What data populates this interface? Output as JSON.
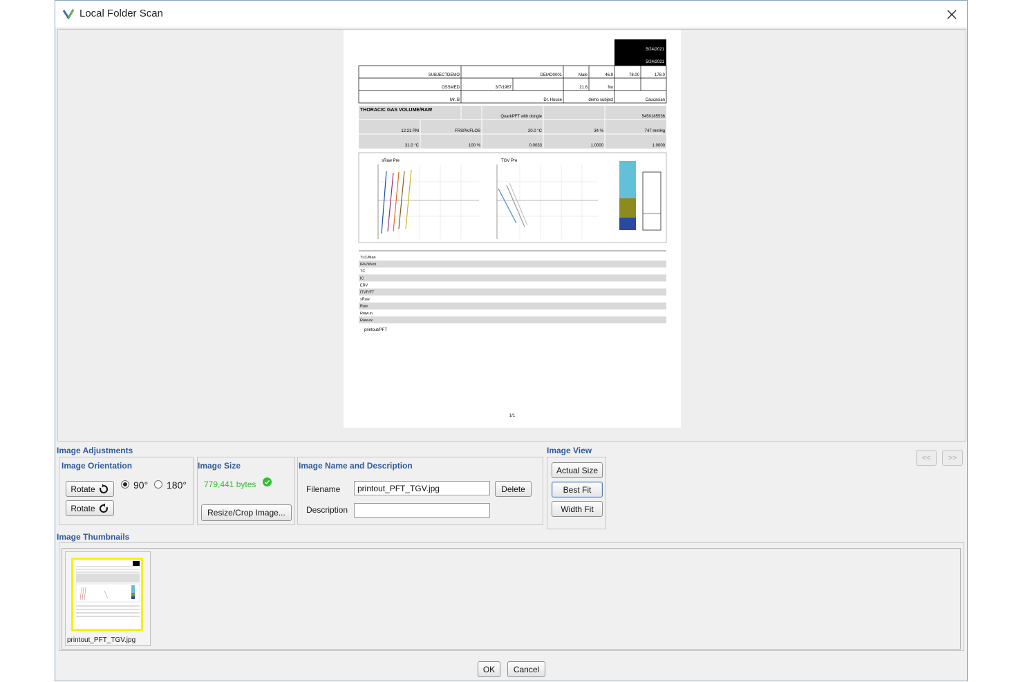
{
  "window": {
    "title": "Local Folder Scan"
  },
  "document": {
    "title": "THORACIC GAS VOLUME/RAW",
    "subject": "SUBJECTDEMO",
    "subject_id": "DEMO0001",
    "gender": "Male",
    "age": "46.9",
    "height": "78.00",
    "weight": "178.0",
    "ethnicity": "OSSMED",
    "dob": "3/7/1967",
    "bmi": "21.6",
    "smoker": "No",
    "operator": "Mr. B",
    "physician": "Dr. House",
    "location": "demo subject",
    "race": "Caucasian",
    "date1": "5/24/2021",
    "date2": "5/24/2021",
    "device": "QuarkPFT with dongle",
    "serial": "5450185536",
    "time": "12:21 PM",
    "source": "FRSPA/FLOS",
    "temp": "20.0 °C",
    "hum": "34 %",
    "press": "747 mmHg",
    "btps": "31.0 °C",
    "o2": "100 %",
    "v1": "0.0033",
    "v2": "1.0000",
    "v3": "1.0000",
    "chart1_title": "sRaw Pre",
    "chart2_title": "TGV Pre",
    "table_rows": [
      "TLC/Man",
      "IRV/MVol",
      "TC",
      "IC",
      "ERV",
      "ITVP/FT",
      "sRaw",
      "Raw",
      "Rtaw.in",
      "Raw.ex"
    ],
    "footer_text": "printout/PFT",
    "page_no": "1/1"
  },
  "adjustments": {
    "heading": "Image Adjustments",
    "orientation": {
      "heading": "Image Orientation",
      "rotate_cw_label": "Rotate",
      "rotate_ccw_label": "Rotate",
      "option_90": "90°",
      "option_180": "180°",
      "selected": "90°"
    },
    "size": {
      "heading": "Image Size",
      "bytes": "779,441 bytes",
      "resize_label": "Resize/Crop Image..."
    },
    "name_desc": {
      "heading": "Image Name and Description",
      "filename_label": "Filename",
      "filename_value": "printout_PFT_TGV.jpg",
      "delete_label": "Delete",
      "description_label": "Description",
      "description_value": ""
    }
  },
  "view": {
    "heading": "Image View",
    "actual_size": "Actual Size",
    "best_fit": "Best Fit",
    "width_fit": "Width Fit"
  },
  "nav": {
    "prev": "<<",
    "next": ">>"
  },
  "thumbnails": {
    "heading": "Image Thumbnails",
    "items": [
      {
        "caption": "printout_PFT_TGV.jpg"
      }
    ]
  },
  "footer": {
    "ok": "OK",
    "cancel": "Cancel"
  },
  "colors": {
    "section_title": "#2f5a9a",
    "success_green": "#2ec02e",
    "thumb_highlight": "#f7f200"
  }
}
